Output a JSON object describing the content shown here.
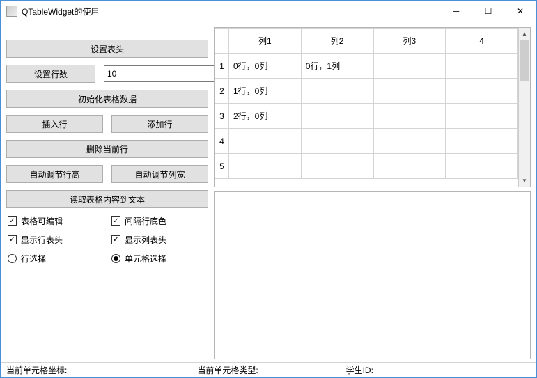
{
  "window": {
    "title": "QTableWidget的使用"
  },
  "left": {
    "set_header": "设置表头",
    "set_row_count": "设置行数",
    "row_count_value": "10",
    "init_data": "初始化表格数据",
    "insert_row": "插入行",
    "append_row": "添加行",
    "delete_row": "删除当前行",
    "auto_row_height": "自动调节行高",
    "auto_col_width": "自动调节列宽",
    "read_to_text": "读取表格内容到文本",
    "editable": "表格可编辑",
    "alt_row_color": "间隔行底色",
    "show_row_header": "显示行表头",
    "show_col_header": "显示列表头",
    "row_select": "行选择",
    "cell_select": "单元格选择"
  },
  "table": {
    "columns": [
      "列1",
      "列2",
      "列3",
      "4"
    ],
    "rows": [
      {
        "h": "1",
        "cells": [
          "0行，0列",
          "0行，1列",
          "",
          ""
        ]
      },
      {
        "h": "2",
        "cells": [
          "1行，0列",
          "",
          "",
          ""
        ]
      },
      {
        "h": "3",
        "cells": [
          "2行，0列",
          "",
          "",
          ""
        ]
      },
      {
        "h": "4",
        "cells": [
          "",
          "",
          "",
          ""
        ]
      },
      {
        "h": "5",
        "cells": [
          "",
          "",
          "",
          ""
        ]
      }
    ]
  },
  "status": {
    "coord_label": "当前单元格坐标:",
    "type_label": "当前单元格类型:",
    "student_label": "学生ID:"
  }
}
